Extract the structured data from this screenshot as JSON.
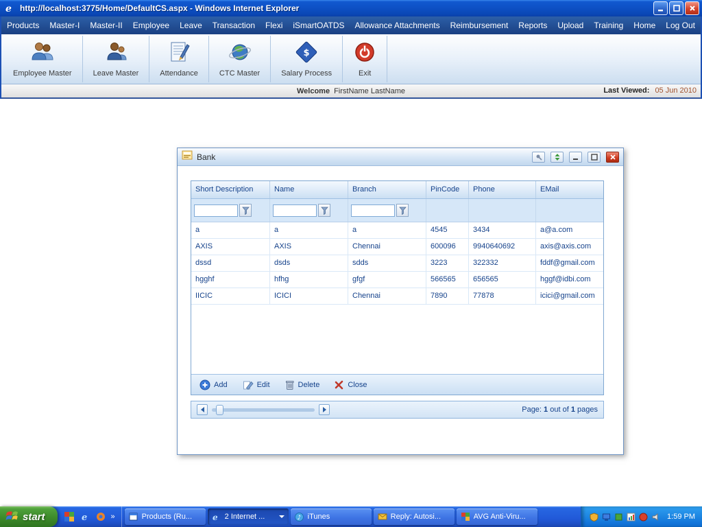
{
  "titlebar": {
    "title": "http://localhost:3775/Home/DefaultCS.aspx - Windows Internet Explorer"
  },
  "menubar": {
    "items": [
      "Products",
      "Master-I",
      "Master-II",
      "Employee",
      "Leave",
      "Transaction",
      "Flexi",
      "iSmartOATDS",
      "Allowance Attachments",
      "Reimbursement",
      "Reports",
      "Upload",
      "Training",
      "Home",
      "Log Out"
    ]
  },
  "toolbar": {
    "items": [
      {
        "label": "Employee Master",
        "icon": "employee-master-icon"
      },
      {
        "label": "Leave Master",
        "icon": "leave-master-icon"
      },
      {
        "label": "Attendance",
        "icon": "attendance-icon"
      },
      {
        "label": "CTC Master",
        "icon": "ctc-master-icon"
      },
      {
        "label": "Salary Process",
        "icon": "salary-process-icon"
      },
      {
        "label": "Exit",
        "icon": "exit-power-icon"
      }
    ]
  },
  "welcomebar": {
    "welcome_label": "Welcome",
    "user_name": "FirstName LastName",
    "last_viewed_label": "Last Viewed:",
    "last_viewed_value": "05 Jun 2010"
  },
  "dialog": {
    "title": "Bank",
    "grid": {
      "columns": [
        "Short Description",
        "Name",
        "Branch",
        "PinCode",
        "Phone",
        "EMail"
      ],
      "rows": [
        [
          "a",
          "a",
          "a",
          "4545",
          "3434",
          "a@a.com"
        ],
        [
          "AXIS",
          "AXIS",
          "Chennai",
          "600096",
          "9940640692",
          "axis@axis.com"
        ],
        [
          "dssd",
          "dsds",
          "sdds",
          "3223",
          "322332",
          "fddf@gmail.com"
        ],
        [
          "hgghf",
          "hfhg",
          "gfgf",
          "566565",
          "656565",
          "hggf@idbi.com"
        ],
        [
          "IICIC",
          "ICICI",
          "Chennai",
          "7890",
          "77878",
          "icici@gmail.com"
        ]
      ]
    },
    "actions": {
      "add": "Add",
      "edit": "Edit",
      "delete": "Delete",
      "close": "Close"
    },
    "pager": {
      "label": "Page:",
      "current": "1",
      "of_text": "out of",
      "total": "1",
      "pages_text": "pages"
    }
  },
  "taskbar": {
    "start_label": "start",
    "tasks": [
      {
        "label": "Products (Ru...",
        "active": false
      },
      {
        "label": "2 Internet ...",
        "active": true
      },
      {
        "label": "iTunes",
        "active": false
      },
      {
        "label": "Reply: Autosi...",
        "active": false
      },
      {
        "label": "AVG Anti-Viru...",
        "active": false
      }
    ],
    "time": "1:59 PM"
  },
  "colors": {
    "title_blue": "#0D50C4",
    "menu_navy": "#1B4082",
    "grid_text": "#15428B",
    "taskbar_blue": "#2159D8",
    "start_green": "#3D8A2A",
    "close_red": "#CE3A1F"
  }
}
